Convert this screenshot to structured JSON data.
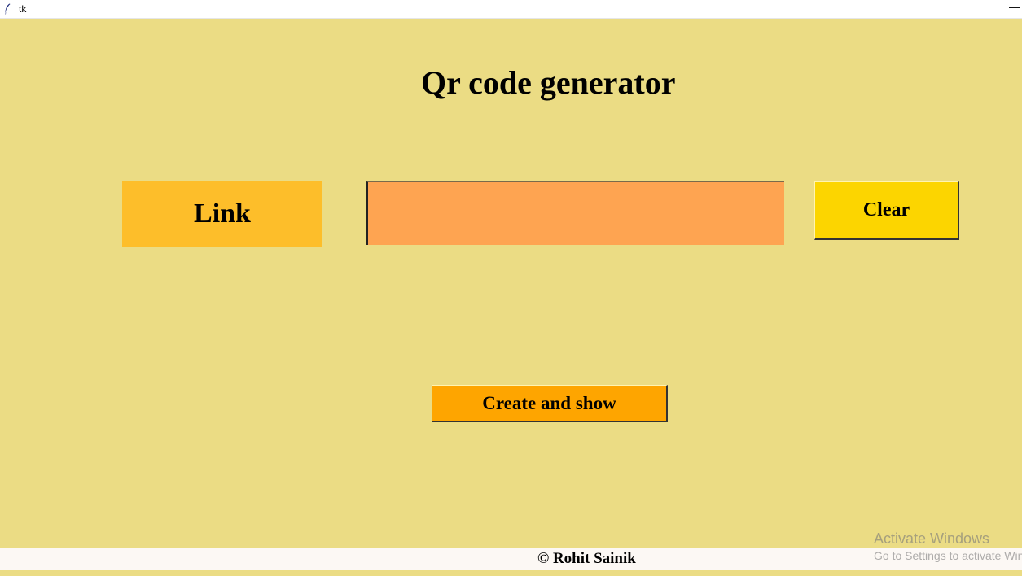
{
  "window": {
    "title": "tk",
    "minimize_glyph": "—"
  },
  "main": {
    "heading": "Qr code generator",
    "link_label": "Link",
    "link_input_value": "",
    "clear_button": "Clear",
    "create_button": "Create and show"
  },
  "footer": {
    "text": "© Rohit Sainik"
  },
  "watermark": {
    "title": "Activate Windows",
    "subtitle": "Go to Settings to activate Windows."
  },
  "colors": {
    "background": "#ebdc84",
    "link_label_bg": "#fdbe2a",
    "input_bg": "#fea451",
    "clear_bg": "#fcd500",
    "create_bg": "#fea500"
  },
  "icons": {
    "app_icon": "tk-feather-icon"
  }
}
